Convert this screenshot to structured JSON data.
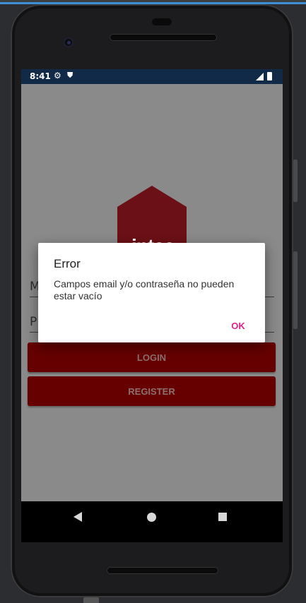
{
  "status_bar": {
    "time": "8:41",
    "icons": [
      "settings-icon",
      "shield-icon",
      "signal-icon",
      "battery-icon"
    ]
  },
  "app": {
    "logo_text": "intec",
    "logo_color": "#d11f2d",
    "email_field_hint": "M",
    "password_field_hint": "P",
    "login_button": "LOGIN",
    "register_button": "REGISTER",
    "button_color": "#660000"
  },
  "dialog": {
    "title": "Error",
    "message": "Campos email y/o contraseña no pueden estar vacío",
    "ok_label": "OK",
    "ok_color": "#e0218a"
  },
  "nav_bar": {
    "icons": [
      "back-icon",
      "home-icon",
      "recent-apps-icon"
    ]
  }
}
